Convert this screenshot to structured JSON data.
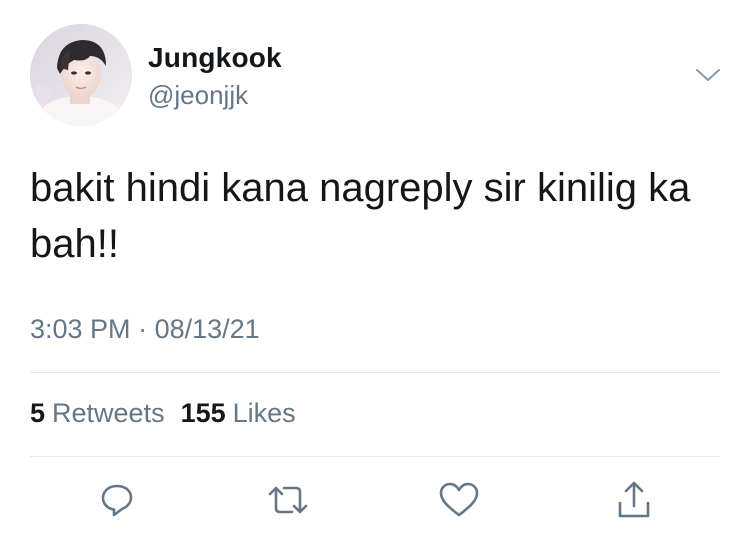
{
  "user": {
    "name": "Jungkook",
    "handle": "@jeonjjk"
  },
  "tweet": {
    "text": "bakit hindi kana nagreply sir kinilig ka bah!!",
    "time": "3:03 PM",
    "separator": "·",
    "date": "08/13/21"
  },
  "stats": {
    "retweets_count": "5",
    "retweets_label": "Retweets",
    "likes_count": "155",
    "likes_label": "Likes"
  },
  "icons": {
    "more": "chevron-down-icon",
    "reply": "reply-icon",
    "retweet": "retweet-icon",
    "like": "heart-icon",
    "share": "share-icon"
  },
  "colors": {
    "text": "#14171a",
    "secondary": "#657786",
    "divider": "#e1e8ed"
  }
}
